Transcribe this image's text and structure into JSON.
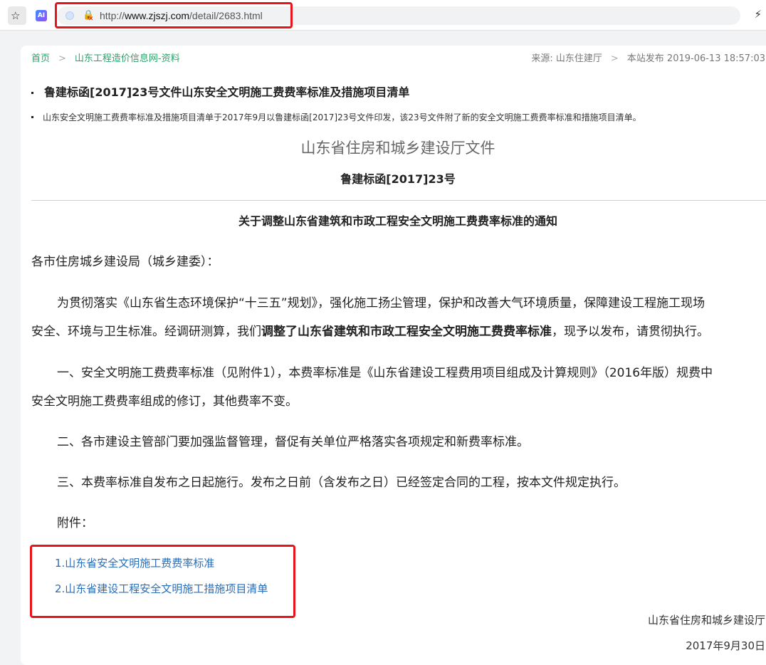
{
  "browser": {
    "url_prefix": "http://",
    "url_domain": "www.zjszj.com",
    "url_path": "/detail/2683.html",
    "ai_badge": "AI"
  },
  "breadcrumb": {
    "home": "首页",
    "separator": ">",
    "section": "山东工程造价信息网-资料"
  },
  "meta": {
    "source": "来源: 山东住建厅",
    "separator": ">",
    "published": "本站发布 2019-06-13 18:57:03"
  },
  "article": {
    "title": "鲁建标函[2017]23号文件山东安全文明施工费费率标准及措施项目清单",
    "description": "山东安全文明施工费费率标准及措施项目清单于2017年9月以鲁建标函[2017]23号文件印发，该23号文件附了新的安全文明施工费费率标准和措施项目清单。",
    "org_header": "山东省住房和城乡建设厅文件",
    "doc_number": "鲁建标函[2017]23号",
    "notice_title": "关于调整山东省建筑和市政工程安全文明施工费费率标准的通知",
    "salutation": "各市住房城乡建设局（城乡建委）：",
    "p1_line1": "为贯彻落实《山东省生态环境保护“十三五”规划》，强化施工扬尘管理，保护和改善大气环境质量，保障建设工程施工现场",
    "p1_line2_a": "安全、环境与卫生标准。经调研测算，我们",
    "p1_line2_bold": "调整了山东省建筑和市政工程安全文明施工费费率标准",
    "p1_line2_b": "，现予以发布，请贯彻执行。",
    "p2_line1": "一、安全文明施工费费率标准（见附件1），本费率标准是《山东省建设工程费用项目组成及计算规则》（2016年版）规费中",
    "p2_line2": "安全文明施工费费率组成的修订，其他费率不变。",
    "p3": "二、各市建设主管部门要加强监督管理，督促有关单位严格落实各项规定和新费率标准。",
    "p4": "三、本费率标准自发布之日起施行。发布之日前（含发布之日）已经签定合同的工程，按本文件规定执行。",
    "attachments_label": "附件：",
    "attachments": [
      "1.山东省安全文明施工费费率标准",
      "2.山东省建设工程安全文明施工措施项目清单"
    ],
    "signature_org": "山东省住房和城乡建设厅",
    "signature_date": "2017年9月30日"
  },
  "colors": {
    "breadcrumb_green": "#2aa26a",
    "link_blue": "#2b6db5",
    "highlight_red": "#e8141b"
  }
}
